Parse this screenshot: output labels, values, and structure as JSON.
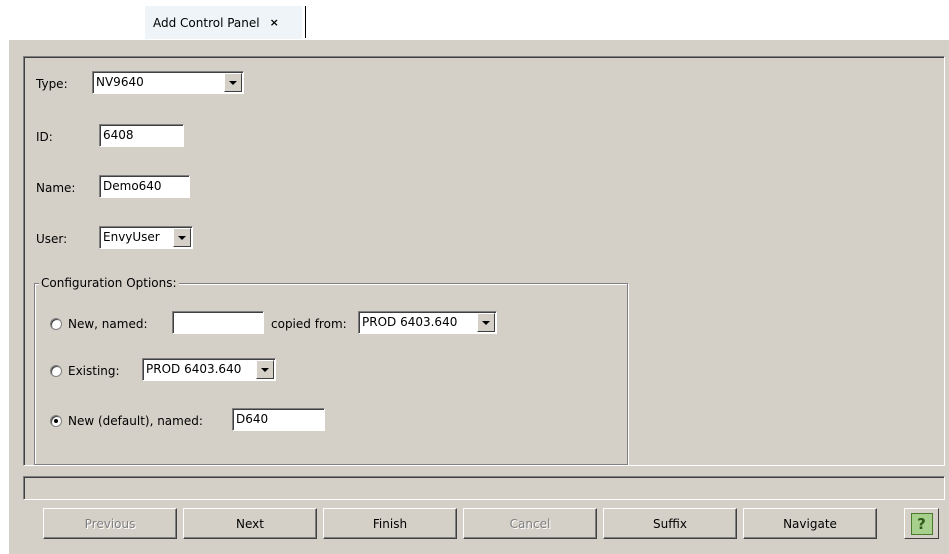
{
  "tab": {
    "title": "Add Control Panel",
    "close_glyph": "×"
  },
  "form": {
    "type": {
      "label": "Type:",
      "value": "NV9640"
    },
    "id": {
      "label": "ID:",
      "value": "6408"
    },
    "name": {
      "label": "Name:",
      "value": "Demo640"
    },
    "user": {
      "label": "User:",
      "value": "EnvyUser"
    }
  },
  "config": {
    "legend": "Configuration Options:",
    "new_named": {
      "label": "New, named:",
      "value": "",
      "copied_label": "copied from:",
      "copied_value": "PROD 6403.640"
    },
    "existing": {
      "label": "Existing:",
      "value": "PROD 6403.640"
    },
    "new_default": {
      "label": "New (default), named:",
      "value": "D640"
    },
    "selected": "new_default"
  },
  "buttons": {
    "previous": "Previous",
    "next": "Next",
    "finish": "Finish",
    "cancel": "Cancel",
    "suffix": "Suffix",
    "navigate": "Navigate",
    "help": "?"
  },
  "colors": {
    "panel_bg": "#d4d0c8",
    "tab_bg": "#eef4f8",
    "help_green": "#a8d08d"
  }
}
